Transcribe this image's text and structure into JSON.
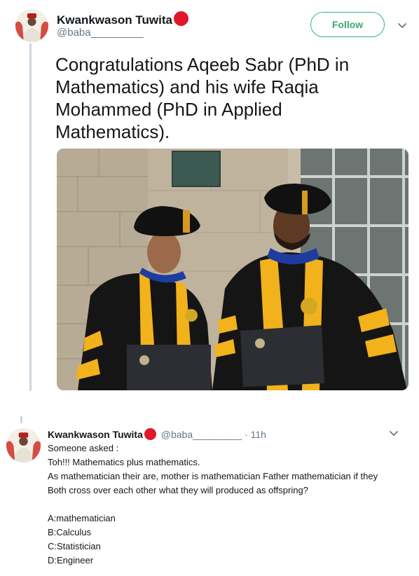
{
  "main_tweet": {
    "author_name": "Kwankwason Tuwita",
    "author_handle": "@baba_________",
    "follow_label": "Follow",
    "text": "Congratulations Aqeeb Sabr (PhD in Mathematics) and his wife Raqia Mohammed (PhD in Applied Mathematics).",
    "photo": "Graduation photo of a man and woman in doctoral gowns and tams holding diplomas"
  },
  "reply_tweet": {
    "author_name": "Kwankwason Tuwita",
    "author_handle": "@baba_________",
    "time": "· 11h",
    "lines": [
      "Someone asked :",
      "Toh!!! Mathematics plus mathematics.",
      "As mathematician their are, mother is mathematician Father mathematician if they Both cross over each other what they will produced as offspring?",
      "",
      "A:mathematician",
      "B:Calculus",
      "C:Statistician",
      "D:Engineer"
    ]
  },
  "colors": {
    "follow_border": "#36b37e",
    "verified_badge": "#e0162b",
    "thread_line": "#ccd6dd",
    "muted_text": "#657786"
  },
  "icons": [
    "chevron-down-icon",
    "avatar",
    "red-circle-badge"
  ]
}
